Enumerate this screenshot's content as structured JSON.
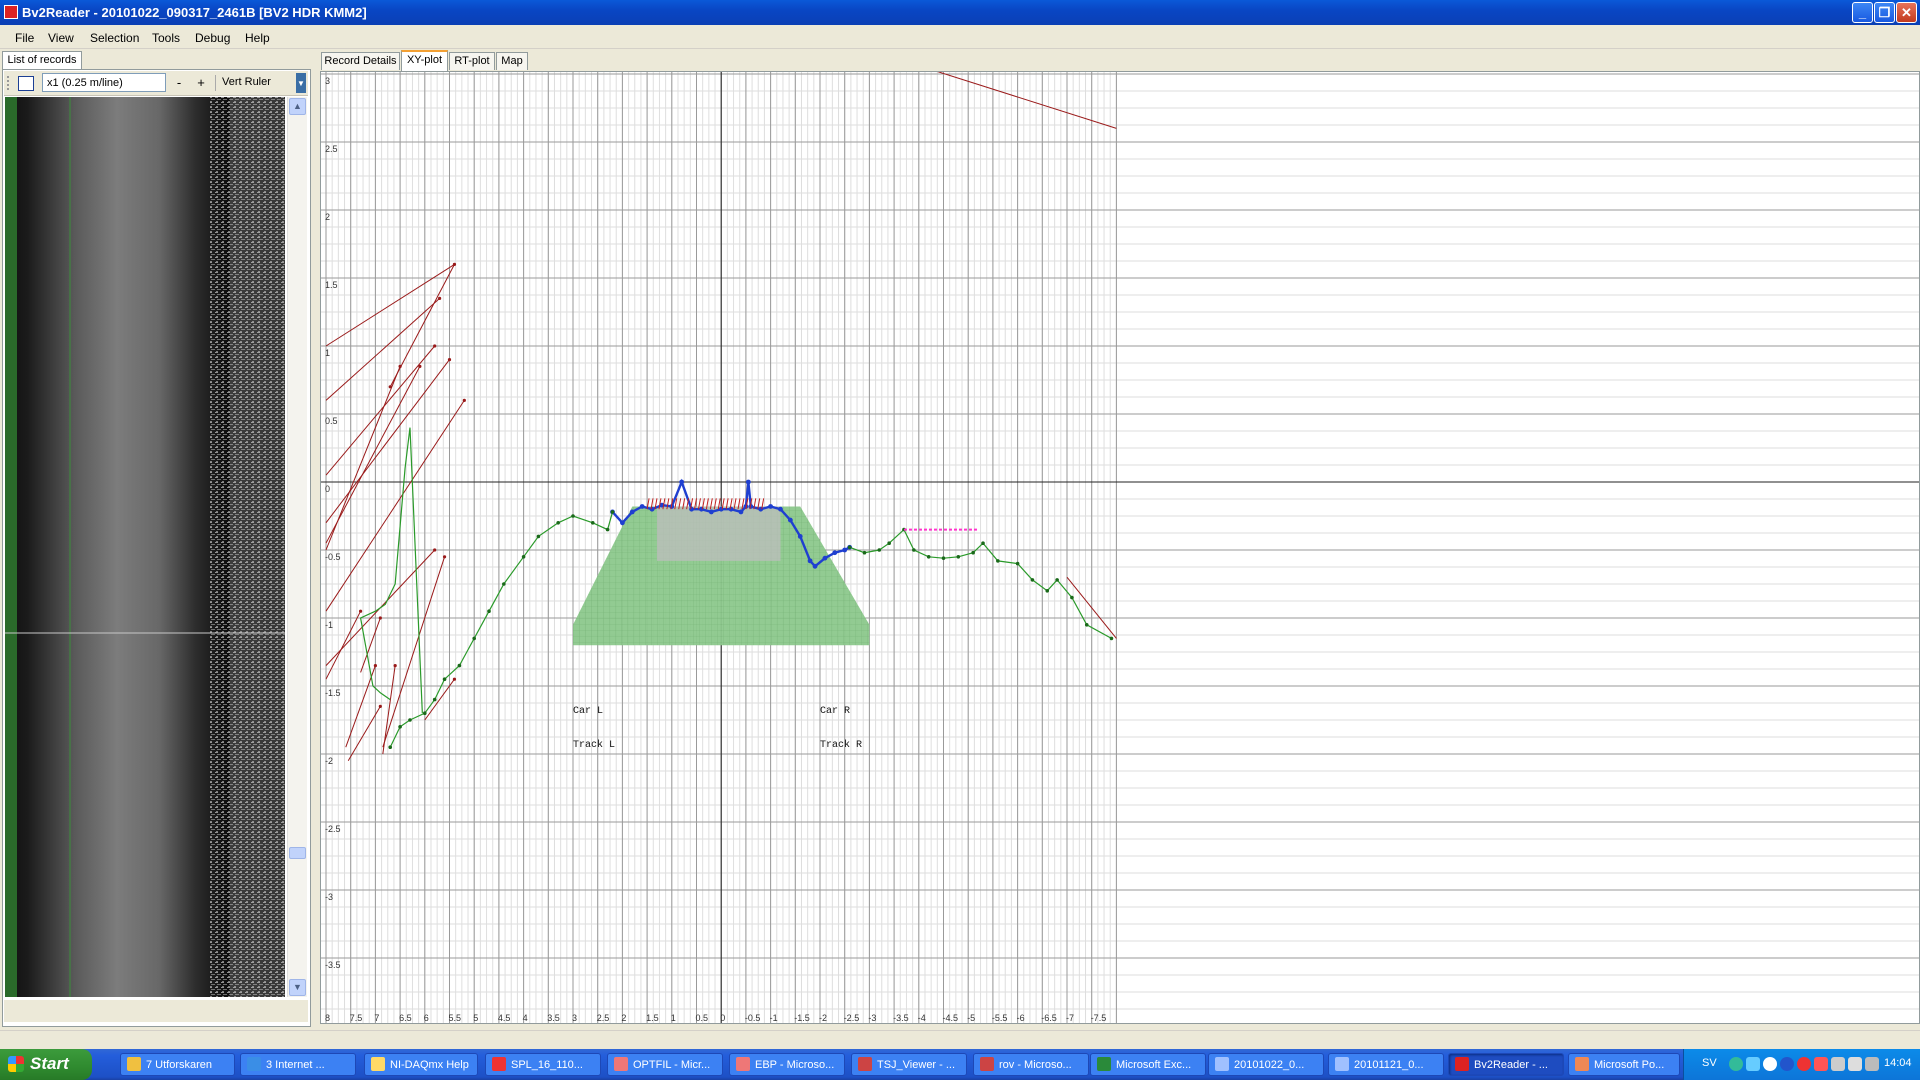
{
  "window": {
    "title": "Bv2Reader - 20101022_090317_2461B [BV2 HDR KMM2]"
  },
  "menu": {
    "file": "File",
    "view": "View",
    "selection": "Selection",
    "tools": "Tools",
    "debug": "Debug",
    "help": "Help"
  },
  "left": {
    "tab": "List of records",
    "zoom_value": "x1 (0.25 m/line)",
    "minus": "-",
    "plus": "+",
    "vert_ruler": "Vert Ruler"
  },
  "tabs": {
    "record_details": "Record Details",
    "xy_plot": "XY-plot",
    "rt_plot": "RT-plot",
    "map": "Map",
    "active": "XY-plot"
  },
  "plot": {
    "y_ticks": [
      "3",
      "2.5",
      "2",
      "1.5",
      "1",
      "0.5",
      "0",
      "-0.5",
      "-1",
      "-1.5",
      "-2",
      "-2.5",
      "-3",
      "-3.5"
    ],
    "x_ticks": [
      "8",
      "7.5",
      "7",
      "6.5",
      "6",
      "5.5",
      "5",
      "4.5",
      "4",
      "3.5",
      "3",
      "2.5",
      "2",
      "1.5",
      "1",
      "0.5",
      "0",
      "-0.5",
      "-1",
      "-1.5",
      "-2",
      "-2.5",
      "-3",
      "-3.5",
      "-4",
      "-4.5",
      "-5",
      "-5.5",
      "-6",
      "-6.5",
      "-7",
      "-7.5"
    ],
    "car_l": "Car L",
    "track_l": "Track L",
    "car_r": "Car R",
    "track_r": "Track R",
    "colors": {
      "profile": "#1f3fd0",
      "trace": "#2a9a2a",
      "aux": "#9a1a1a",
      "dotted": "#ff33cc",
      "fill": "#8cc88c"
    }
  },
  "chart_data": {
    "type": "line",
    "xlim": [
      8,
      -8
    ],
    "ylim": [
      -4.1,
      3
    ],
    "grid": true,
    "series": [
      {
        "values": [
          [
            2.2,
            -0.22
          ],
          [
            2.0,
            -0.3
          ],
          [
            1.8,
            -0.22
          ],
          [
            1.6,
            -0.18
          ],
          [
            1.4,
            -0.2
          ],
          [
            1.2,
            -0.17
          ],
          [
            1.0,
            -0.18
          ],
          [
            0.8,
            -0.0
          ],
          [
            0.6,
            -0.2
          ],
          [
            0.4,
            -0.2
          ],
          [
            0.2,
            -0.22
          ],
          [
            0,
            -0.2
          ],
          [
            -0.2,
            -0.2
          ],
          [
            -0.4,
            -0.22
          ],
          [
            -0.5,
            -0.18
          ],
          [
            -0.55,
            0.0
          ],
          [
            -0.6,
            -0.18
          ],
          [
            -0.8,
            -0.2
          ],
          [
            -1.0,
            -0.18
          ],
          [
            -1.2,
            -0.2
          ],
          [
            -1.4,
            -0.28
          ],
          [
            -1.6,
            -0.4
          ],
          [
            -1.8,
            -0.58
          ],
          [
            -1.9,
            -0.62
          ],
          [
            -2.1,
            -0.56
          ],
          [
            -2.3,
            -0.52
          ],
          [
            -2.5,
            -0.5
          ],
          [
            -2.6,
            -0.48
          ]
        ]
      },
      {
        "values": [
          [
            6.7,
            -1.95
          ],
          [
            6.5,
            -1.8
          ],
          [
            6.3,
            -1.75
          ],
          [
            6.0,
            -1.7
          ],
          [
            5.8,
            -1.6
          ],
          [
            5.6,
            -1.45
          ],
          [
            5.3,
            -1.35
          ],
          [
            5.0,
            -1.15
          ],
          [
            4.7,
            -0.95
          ],
          [
            4.4,
            -0.75
          ],
          [
            4.0,
            -0.55
          ],
          [
            3.7,
            -0.4
          ],
          [
            3.3,
            -0.3
          ],
          [
            3.0,
            -0.25
          ],
          [
            2.6,
            -0.3
          ],
          [
            2.3,
            -0.35
          ],
          [
            2.2,
            -0.22
          ]
        ]
      },
      {
        "values": [
          [
            -2.6,
            -0.48
          ],
          [
            -2.9,
            -0.52
          ],
          [
            -3.2,
            -0.5
          ],
          [
            -3.4,
            -0.45
          ],
          [
            -3.7,
            -0.35
          ],
          [
            -3.9,
            -0.5
          ],
          [
            -4.2,
            -0.55
          ],
          [
            -4.5,
            -0.56
          ],
          [
            -4.8,
            -0.55
          ],
          [
            -5.1,
            -0.52
          ],
          [
            -5.3,
            -0.45
          ],
          [
            -5.6,
            -0.58
          ],
          [
            -6.0,
            -0.6
          ],
          [
            -6.3,
            -0.72
          ],
          [
            -6.6,
            -0.8
          ],
          [
            -6.8,
            -0.72
          ],
          [
            -7.1,
            -0.85
          ],
          [
            -7.4,
            -1.05
          ],
          [
            -7.9,
            -1.15
          ]
        ]
      },
      {
        "values": [
          [
            -3.7,
            -0.35
          ],
          [
            -5.2,
            -0.35
          ]
        ]
      }
    ]
  }
}
